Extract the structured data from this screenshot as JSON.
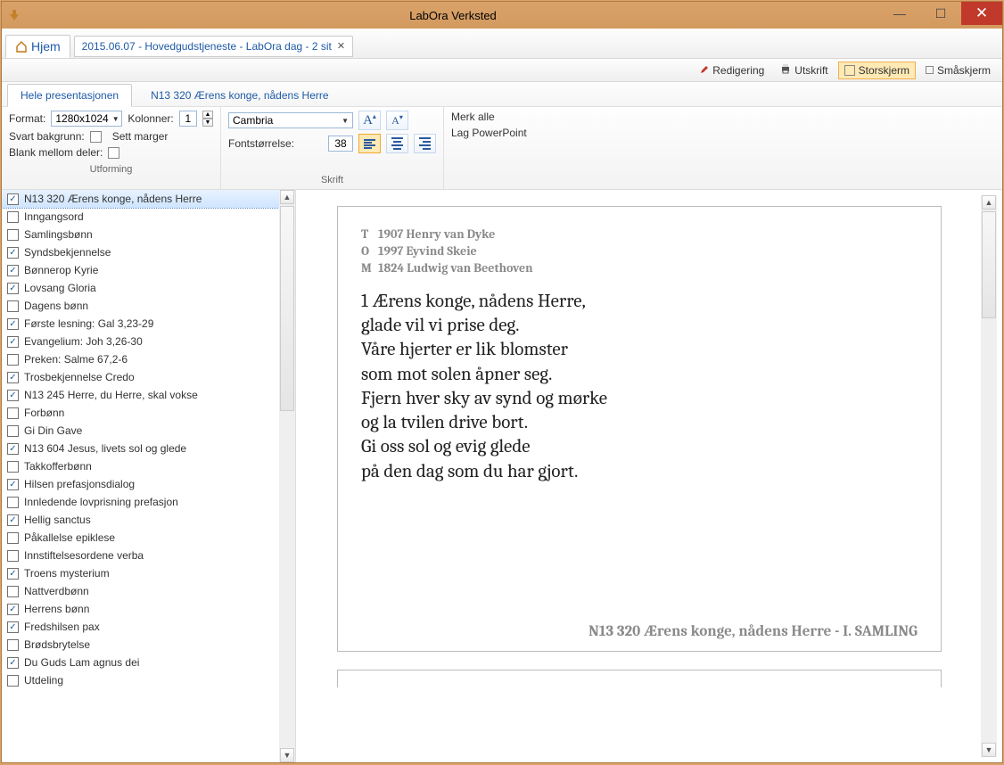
{
  "titlebar": {
    "title": "LabOra Verksted"
  },
  "menu": {
    "home": "Hjem",
    "doc_tab": "2015.06.07 - Hovedgudstjeneste - LabOra dag - 2 sit"
  },
  "top_toolbar": {
    "redigering": "Redigering",
    "utskrift": "Utskrift",
    "storskjerm": "Storskjerm",
    "smaskjerm": "Småskjerm"
  },
  "inner_tabs": {
    "all": "Hele presentasjonen",
    "current": "N13 320  Ærens konge, nådens Herre"
  },
  "ribbon": {
    "format_label": "Format:",
    "format_value": "1280x1024",
    "kolonner_label": "Kolonner:",
    "kolonner_value": "1",
    "svart_bg": "Svart bakgrunn:",
    "sett_marger": "Sett marger",
    "blank_deler": "Blank mellom deler:",
    "group1_caption": "Utforming",
    "font_value": "Cambria",
    "fontstr_label": "Fontstørrelse:",
    "fontstr_value": "38",
    "group2_caption": "Skrift",
    "merk_alle": "Merk alle",
    "lag_ppt": "Lag PowerPoint"
  },
  "items": [
    {
      "label": "N13 320  Ærens konge, nådens Herre",
      "checked": true,
      "selected": true
    },
    {
      "label": "Inngangsord",
      "checked": false
    },
    {
      "label": "Samlingsbønn",
      "checked": false
    },
    {
      "label": "Syndsbekjennelse",
      "checked": true
    },
    {
      "label": "Bønnerop Kyrie",
      "checked": true
    },
    {
      "label": "Lovsang Gloria",
      "checked": true
    },
    {
      "label": "Dagens bønn",
      "checked": false
    },
    {
      "label": "Første lesning: Gal 3,23-29",
      "checked": true
    },
    {
      "label": "Evangelium: Joh 3,26-30",
      "checked": true
    },
    {
      "label": "Preken: Salme 67,2-6",
      "checked": false
    },
    {
      "label": "Trosbekjennelse Credo",
      "checked": true
    },
    {
      "label": "N13 245  Herre, du Herre, skal vokse",
      "checked": true
    },
    {
      "label": "Forbønn",
      "checked": false
    },
    {
      "label": "Gi Din Gave",
      "checked": false
    },
    {
      "label": "N13 604  Jesus, livets sol og glede",
      "checked": true
    },
    {
      "label": "Takkofferbønn",
      "checked": false
    },
    {
      "label": "Hilsen prefasjonsdialog",
      "checked": true
    },
    {
      "label": "Innledende lovprisning prefasjon",
      "checked": false
    },
    {
      "label": "Hellig sanctus",
      "checked": true
    },
    {
      "label": "Påkallelse epiklese",
      "checked": false
    },
    {
      "label": "Innstiftelsesordene verba",
      "checked": false
    },
    {
      "label": "Troens mysterium",
      "checked": true
    },
    {
      "label": "Nattverdbønn",
      "checked": false
    },
    {
      "label": "Herrens bønn",
      "checked": true
    },
    {
      "label": "Fredshilsen pax",
      "checked": true
    },
    {
      "label": "Brødsbrytelse",
      "checked": false
    },
    {
      "label": "Du Guds Lam agnus dei",
      "checked": true
    },
    {
      "label": "Utdeling",
      "checked": false
    }
  ],
  "slide": {
    "meta": {
      "T": "1907 Henry van Dyke",
      "O": "1997 Eyvind Skeie",
      "M": "1824 Ludwig van Beethoven"
    },
    "verse_lines": [
      "1 Ærens konge, nådens Herre,",
      "glade vil vi prise deg.",
      "Våre hjerter er lik blomster",
      "som mot solen åpner seg.",
      "Fjern hver sky av synd og mørke",
      "og la tvilen drive bort.",
      "Gi oss sol og evig glede",
      "på den dag som du har gjort."
    ],
    "footer": "N13 320 Ærens konge, nådens Herre - I. SAMLING"
  }
}
